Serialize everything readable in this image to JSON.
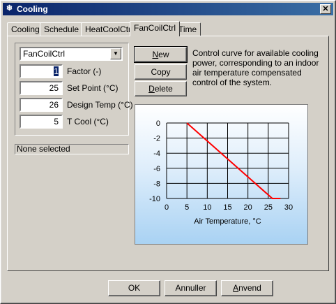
{
  "window": {
    "title": "Cooling",
    "close_label": "✕",
    "icon_glyph": "❄"
  },
  "tabs": [
    "Cooling",
    "Schedule",
    "HeatCoolCtrl",
    "FanCoilCtrl",
    "Time"
  ],
  "active_tab": "FanCoilCtrl",
  "combo": {
    "value": "FanCoilCtrl",
    "arrow": "▼"
  },
  "fields": [
    {
      "value": "1",
      "label": "Factor (-)"
    },
    {
      "value": "25",
      "label": "Set Point (°C)"
    },
    {
      "value": "26",
      "label": "Design Temp (°C)"
    },
    {
      "value": "5",
      "label": "T Cool (°C)"
    }
  ],
  "status_text": "None selected",
  "side_buttons": {
    "new_label": "New",
    "copy_label": "Copy",
    "delete_label": "Delete"
  },
  "description": "Control curve for available cooling power, corresponding to an indoor air temperature compensated control of the system.",
  "chart_data": {
    "type": "line",
    "xlabel": "Air Temperature, °C",
    "ylabel": "",
    "xlim": [
      0,
      30
    ],
    "ylim": [
      -10,
      0
    ],
    "x_ticks": [
      0,
      5,
      10,
      15,
      20,
      25,
      30
    ],
    "y_ticks": [
      0,
      -2,
      -4,
      -6,
      -8,
      -10
    ],
    "grid": true,
    "series": [
      {
        "x": [
          5,
          26,
          28
        ],
        "y": [
          0,
          -10,
          -10
        ],
        "color": "#ff0000"
      }
    ]
  },
  "bottom_buttons": {
    "ok_label": "OK",
    "cancel_label": "Annuller",
    "apply_label": "Anvend"
  }
}
